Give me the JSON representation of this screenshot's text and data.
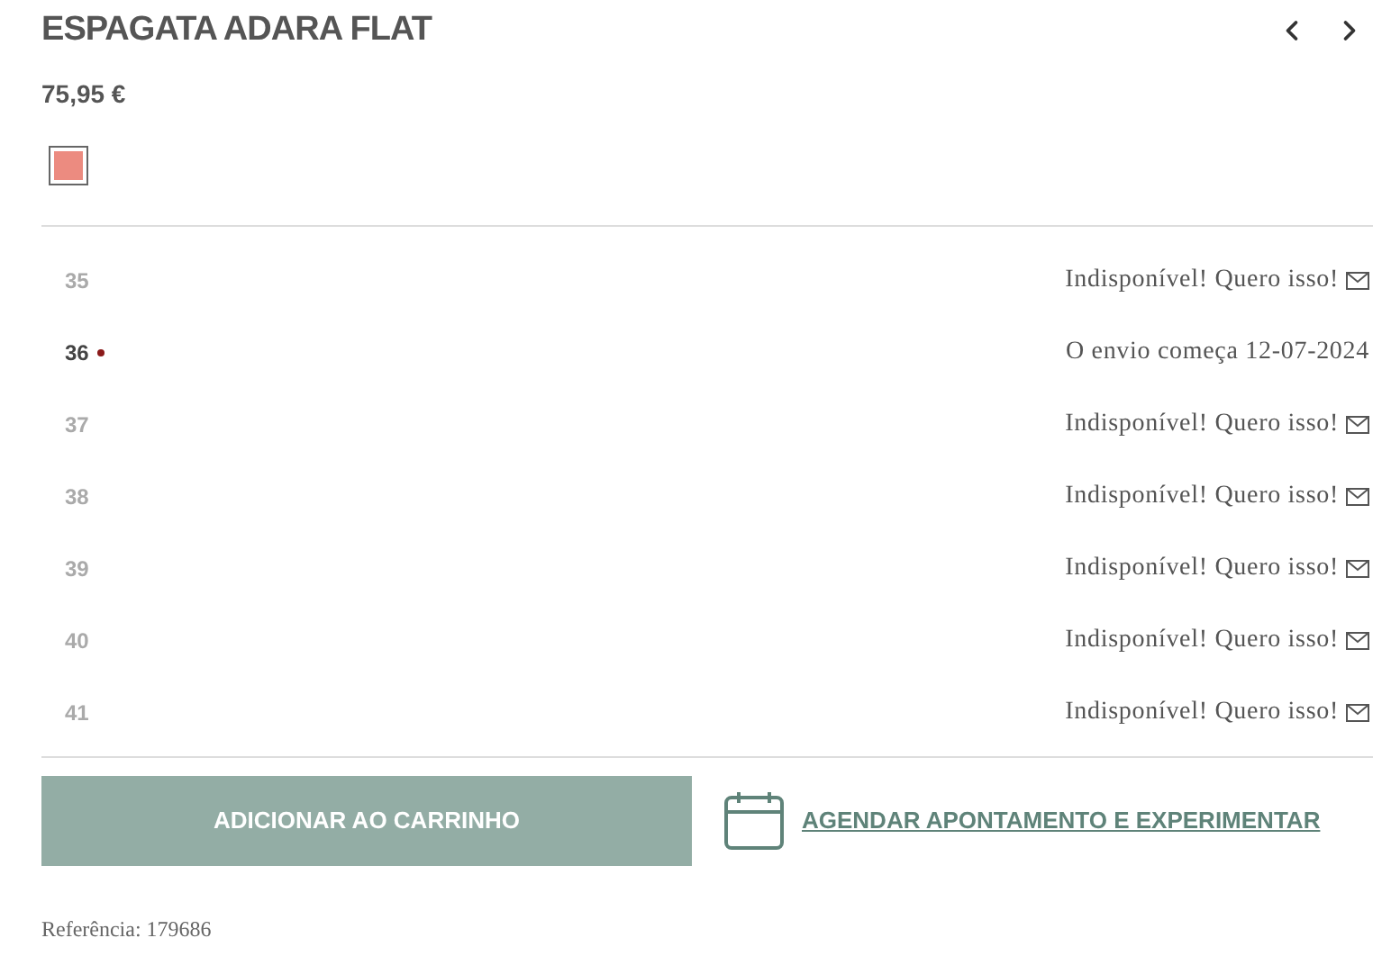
{
  "product": {
    "title": "ESPAGATA ADARA FLAT",
    "price": "75,95 €"
  },
  "colors": [
    {
      "color": "#ec8b80",
      "selected": true
    }
  ],
  "sizes": [
    {
      "size": "35",
      "available": false,
      "status": "Indisponível! Quero isso!"
    },
    {
      "size": "36",
      "available": true,
      "status": "O envio começa 12-07-2024"
    },
    {
      "size": "37",
      "available": false,
      "status": "Indisponível! Quero isso!"
    },
    {
      "size": "38",
      "available": false,
      "status": "Indisponível! Quero isso!"
    },
    {
      "size": "39",
      "available": false,
      "status": "Indisponível! Quero isso!"
    },
    {
      "size": "40",
      "available": false,
      "status": "Indisponível! Quero isso!"
    },
    {
      "size": "41",
      "available": false,
      "status": "Indisponível! Quero isso!"
    }
  ],
  "actions": {
    "add_to_cart": "ADICIONAR AO CARRINHO",
    "appointment": "AGENDAR APONTAMENTO E EXPERIMENTAR"
  },
  "reference": "Referência: 179686"
}
